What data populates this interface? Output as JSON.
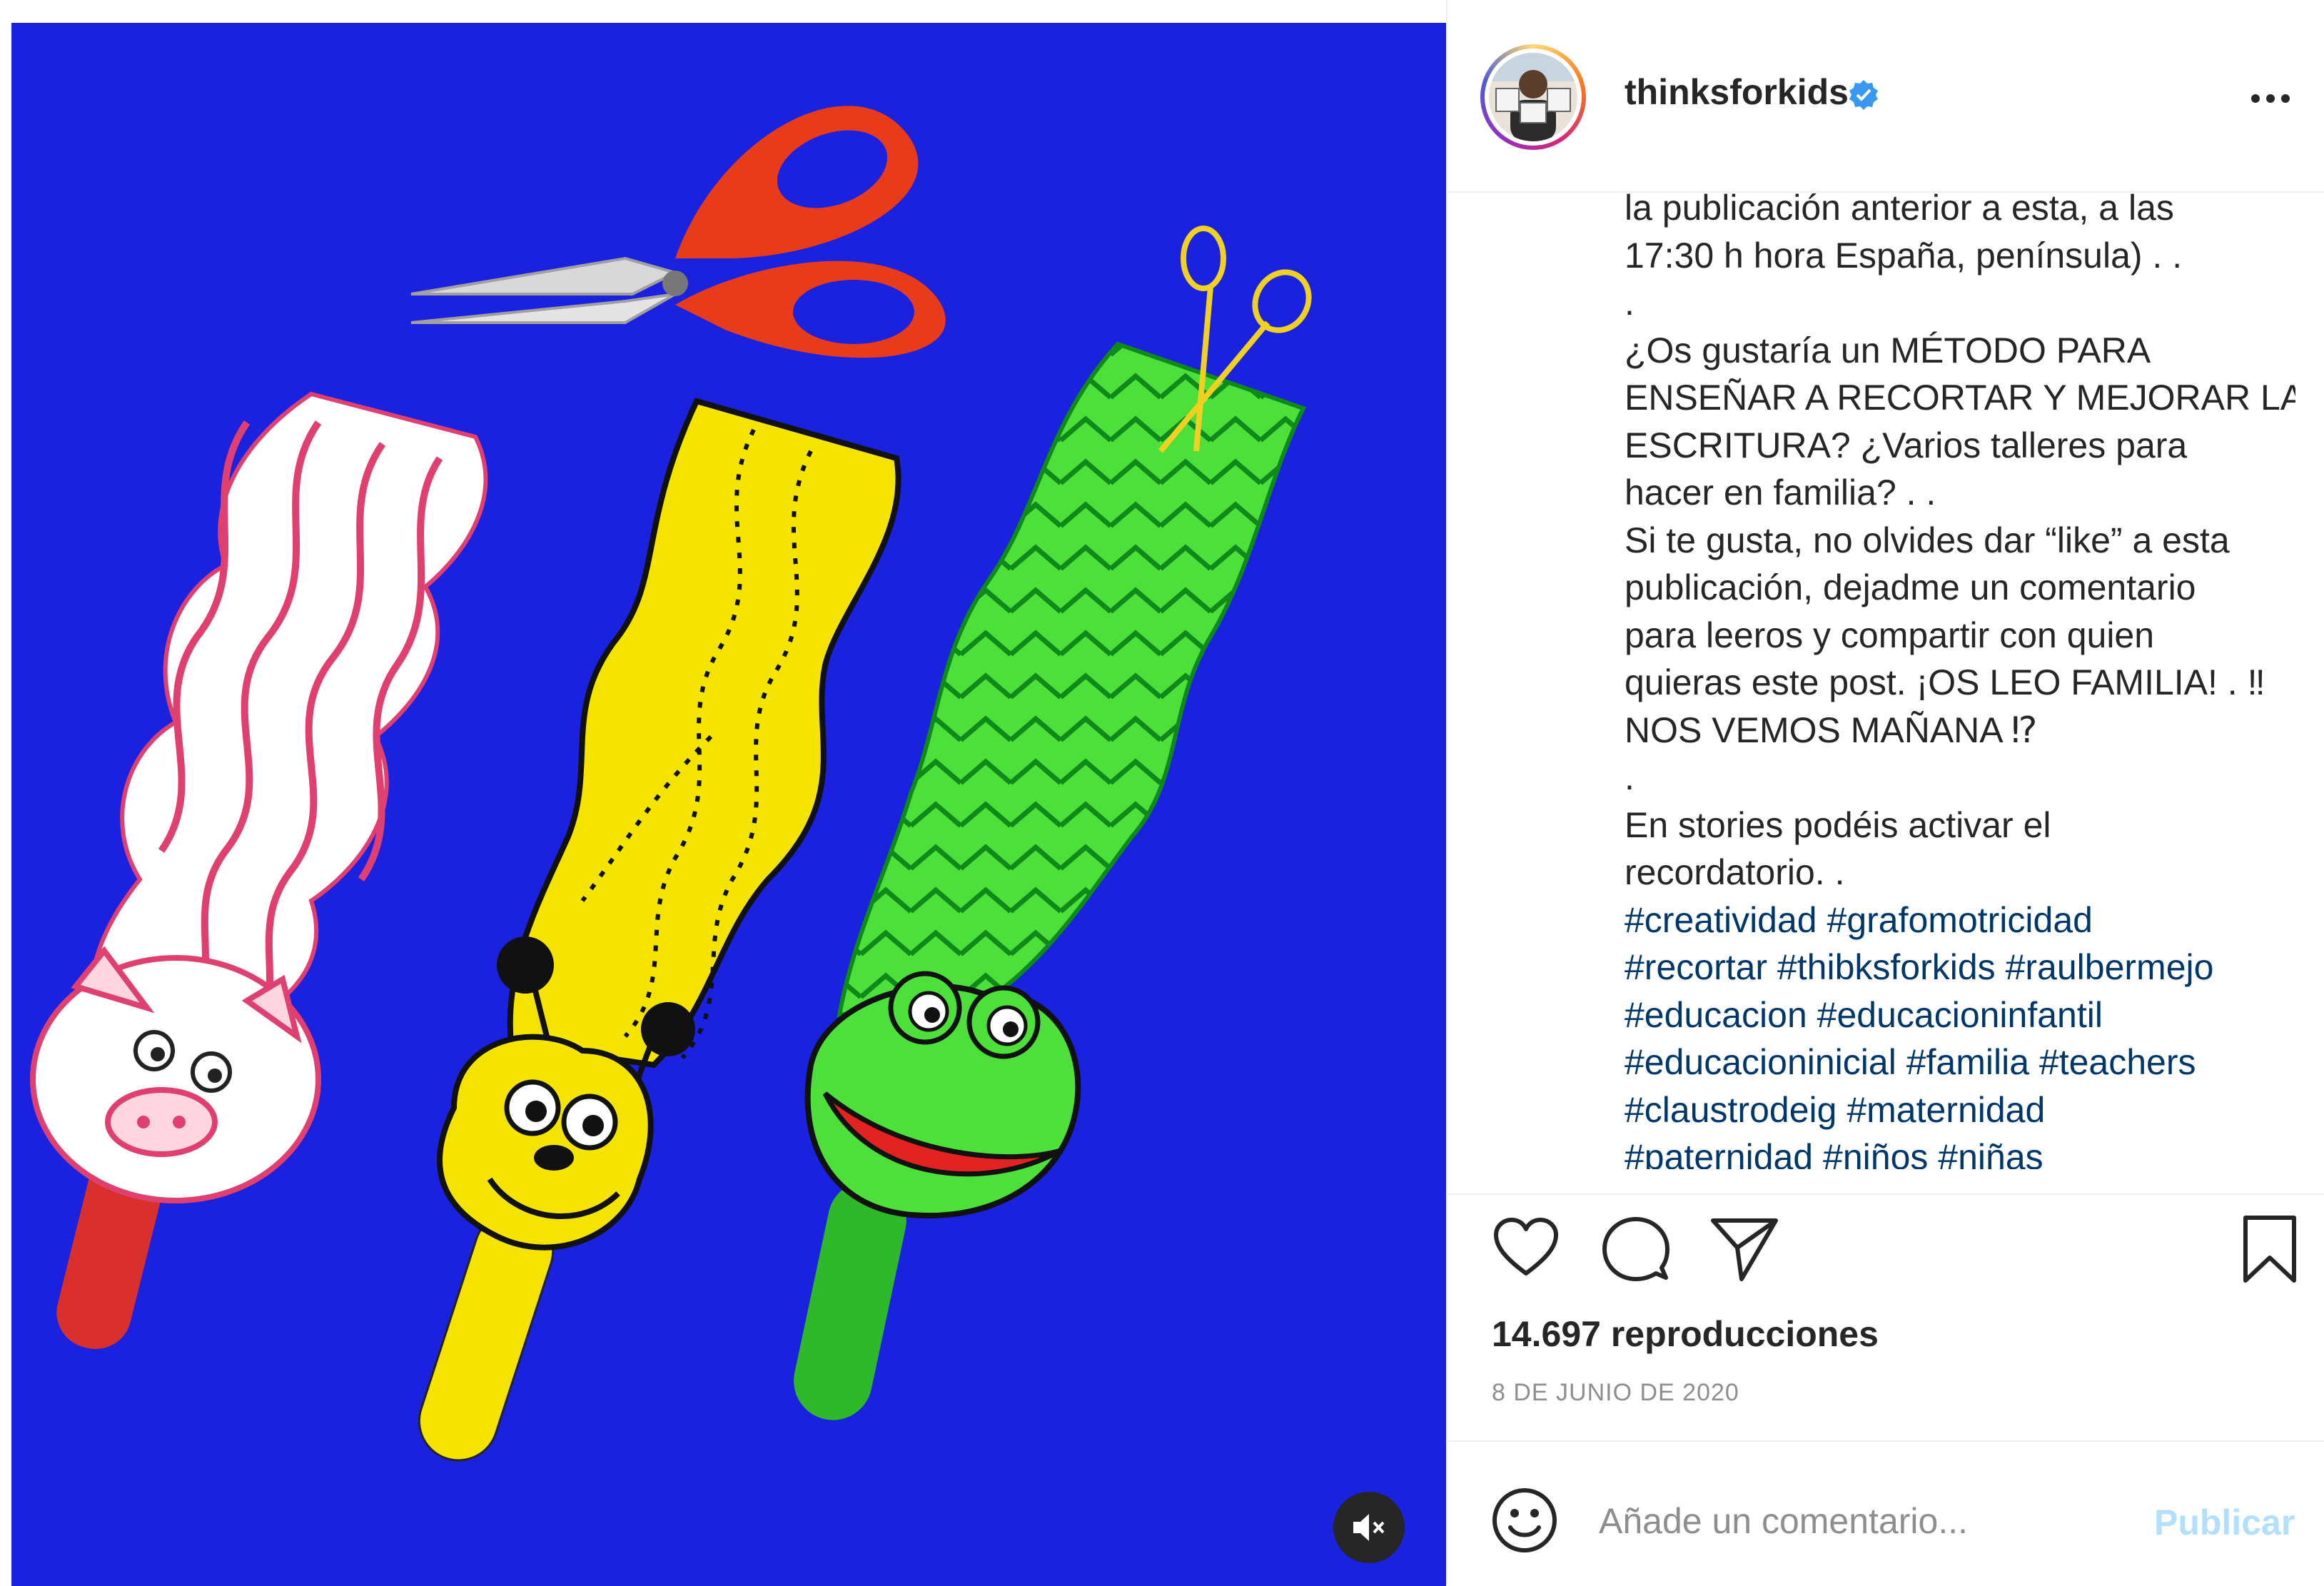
{
  "post": {
    "username": "thinksforkids",
    "caption_lines": [
      "la publicación anterior a esta, a las",
      "17:30 h hora España, península) . .",
      ".",
      "¿Os gustaría un MÉTODO PARA",
      "ENSEÑAR A RECORTAR Y MEJORAR LA",
      "ESCRITURA? ¿Varios talleres para",
      "hacer en familia? . .",
      "Si te gusta, no olvides dar “like” a esta",
      "publicación, dejadme un comentario",
      "para leeros y compartir con quien",
      "quieras este post. ¡OS LEO FAMILIA! . ‼",
      "NOS VEMOS MAÑANA ⁉",
      ".",
      "En stories podéis activar el",
      "recordatorio. ."
    ],
    "hashtag_lines": [
      [
        "#creatividad",
        "#grafomotricidad"
      ],
      [
        "#recortar",
        "#thibksforkids",
        "#raulbermejo"
      ],
      [
        "#educacion",
        "#educacioninfantil"
      ],
      [
        "#educacioninicial",
        "#familia",
        "#teachers"
      ],
      [
        "#claustrodeig",
        "#maternidad"
      ],
      [
        "#paternidad",
        "#niños",
        "#niñas"
      ]
    ],
    "views": "14.697 reproducciones",
    "date": "8 DE JUNIO DE 2020",
    "comment_placeholder": "Añade un comentario...",
    "publish_label": "Publicar"
  },
  "icons": {
    "verified": "verified-badge-icon",
    "more": "more-options-icon",
    "like": "heart-icon",
    "comment": "comment-icon",
    "share": "paper-plane-icon",
    "save": "bookmark-icon",
    "emoji": "emoji-icon",
    "mute": "speaker-muted-icon"
  },
  "colors": {
    "media_background": "#1a22e0",
    "hashtag": "#00376b",
    "verified": "#3897f0",
    "publish_disabled": "#b2dffc",
    "meta_gray": "#8e8e8e"
  }
}
